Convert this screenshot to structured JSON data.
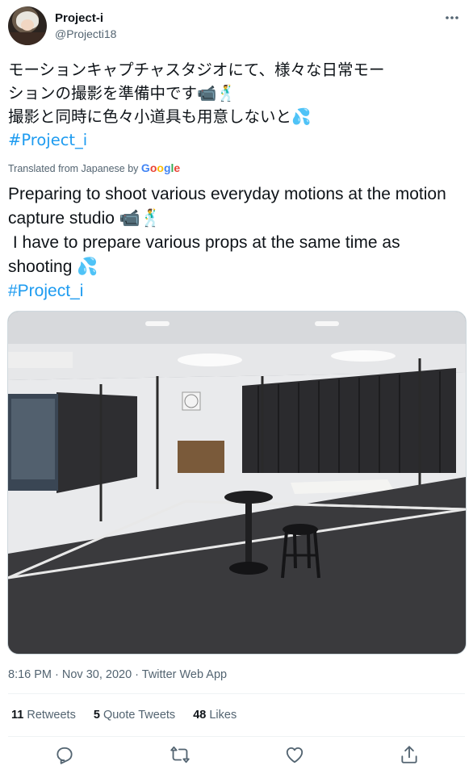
{
  "user": {
    "name": "Project-i",
    "handle": "@Projecti18"
  },
  "tweet": {
    "text_lines": [
      "モーションキャプチャスタジオにて、様々な日常モー",
      "ションの撮影を準備中です📹🕺",
      "撮影と同時に色々小道具も用意しないと💦"
    ],
    "hashtag": "#Project_i"
  },
  "translation": {
    "label": "Translated from Japanese by",
    "provider": "Google",
    "text": "Preparing to shoot various everyday motions at the motion capture studio 📹🕺\n I have to prepare various props at the same time as shooting 💦",
    "hashtag": "#Project_i"
  },
  "meta": {
    "time": "8:16 PM",
    "date": "Nov 30, 2020",
    "source": "Twitter Web App",
    "separator": " · "
  },
  "stats": {
    "retweets_count": "11",
    "retweets_label": " Retweets",
    "quotes_count": "5",
    "quotes_label": " Quote Tweets",
    "likes_count": "48",
    "likes_label": " Likes"
  },
  "actions": {
    "icons": [
      "reply-icon",
      "retweet-icon",
      "like-icon",
      "share-icon"
    ]
  },
  "colors": {
    "link": "#1d9bf0",
    "secondary_text": "#536471",
    "divider": "#eff3f4"
  }
}
